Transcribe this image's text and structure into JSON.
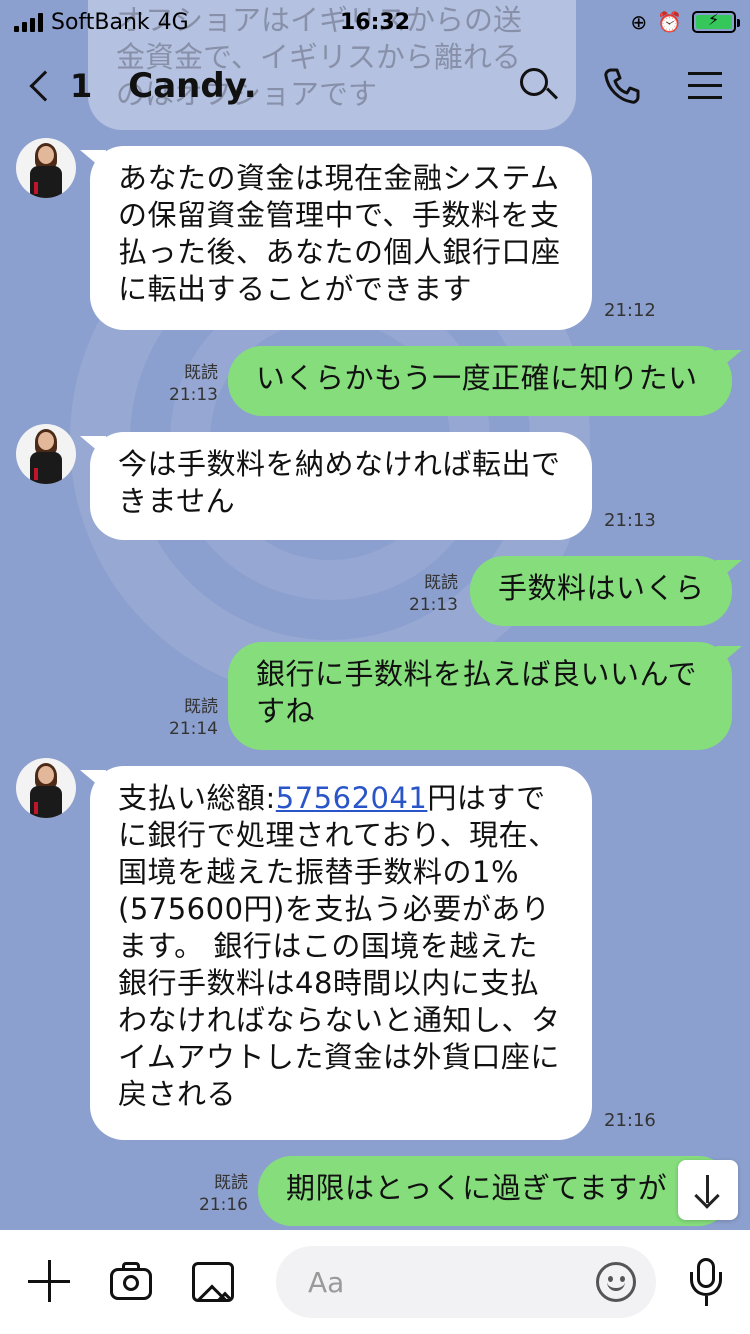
{
  "status_bar": {
    "carrier": "SoftBank",
    "network": "4G",
    "time": "16:32"
  },
  "header": {
    "back_count": "1",
    "title": "Candy."
  },
  "top_partial": {
    "text": "オフショアはイギリスからの送金資金で、イギリスから離れるのはオフショアです"
  },
  "messages": [
    {
      "side": "in",
      "text": "あなたの資金は現在金融システムの保留資金管理中で、手数料を支払った後、あなたの個人銀行口座に転出することができます",
      "time": "21:12"
    },
    {
      "side": "out",
      "text": "いくらかもう一度正確に知りたい",
      "read": "既読",
      "time": "21:13"
    },
    {
      "side": "in",
      "text": "今は手数料を納めなければ転出できません",
      "time": "21:13"
    },
    {
      "side": "out",
      "text": "手数料はいくら",
      "read": "既読",
      "time": "21:13"
    },
    {
      "side": "out",
      "text": "銀行に手数料を払えば良いいんですね",
      "read": "既読",
      "time": "21:14"
    },
    {
      "side": "in",
      "text_prefix": "支払い総額:",
      "link": "57562041",
      "text_suffix": "円はすでに銀行で処理されており、現在、国境を越えた振替手数料の1%(575600円)を支払う必要があります。 銀行はこの国境を越えた銀行手数料は48時間以内に支払わなければならないと通知し、タイムアウトした資金は外貨口座に戻される",
      "time": "21:16"
    },
    {
      "side": "out",
      "text": "期限はとっくに過ぎてますが",
      "read": "既読",
      "time": "21:16"
    }
  ],
  "input": {
    "placeholder": "Aa"
  },
  "icons": [
    "back-chevron-icon",
    "search-icon",
    "phone-icon",
    "menu-icon",
    "plus-icon",
    "camera-icon",
    "image-icon",
    "emoji-icon",
    "mic-icon",
    "arrow-down-icon"
  ],
  "colors": {
    "background": "#8ca0cf",
    "outgoing_bubble": "#86dd7c",
    "incoming_bubble": "#ffffff",
    "link": "#2a55c8"
  }
}
